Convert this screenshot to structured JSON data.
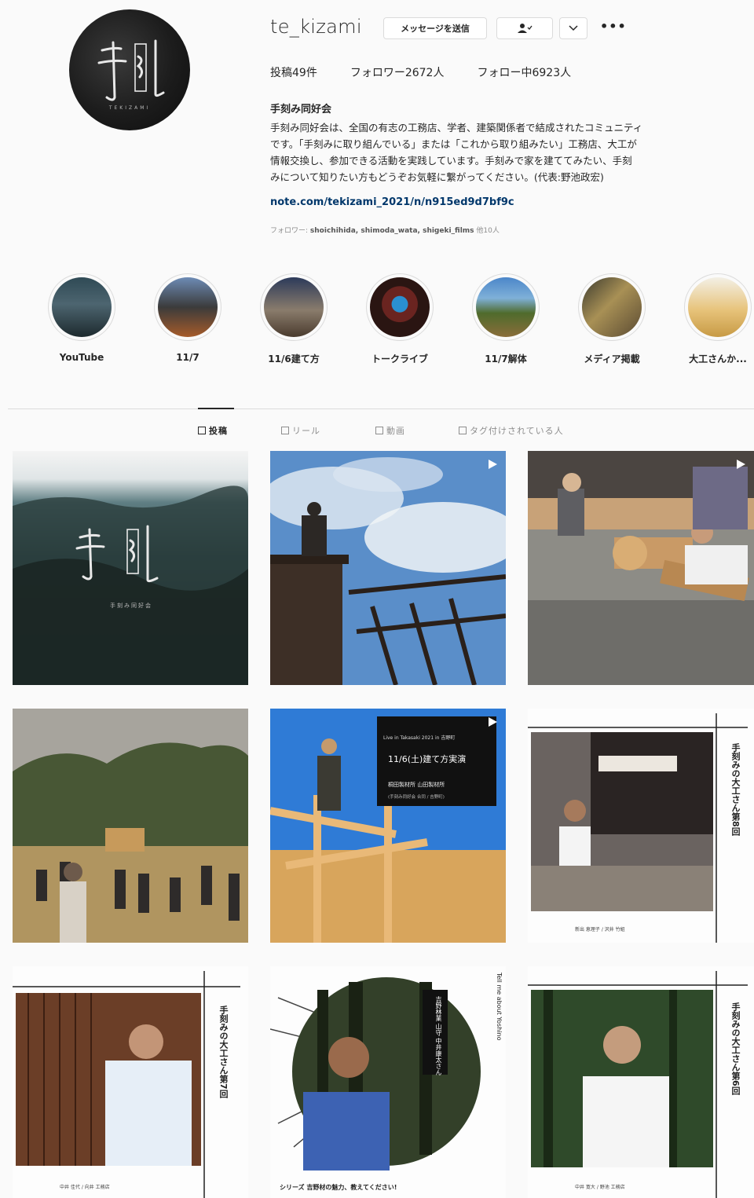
{
  "profile": {
    "username": "te_kizami",
    "avatar_text": "手刻",
    "avatar_sub": "TEKIZAMI",
    "message_button": "メッセージを送信",
    "follow_icon": "person-check-icon",
    "dropdown_icon": "chevron-down-icon",
    "more_icon": "•••",
    "stats": {
      "posts": "投稿49件",
      "followers": "フォロワー2672人",
      "following": "フォロー中6923人"
    },
    "bio_name": "手刻み同好会",
    "bio_text": "手刻み同好会は、全国の有志の工務店、学者、建築関係者で結成されたコミュニティ\nです。「手刻みに取り組んでいる」または「これから取り組みたい」工務店、大工が\n情報交換し、参加できる活動を実践しています。手刻みで家を建ててみたい、手刻\nみについて知りたい方もどうぞお気軽に繋がってください。(代表:野池政宏)",
    "bio_link": "note.com/tekizami_2021/n/n915ed9d7bf9c",
    "followed_by_prefix": "フォロワー:",
    "followed_by_names": "shoichihida, shimoda_wata, shigeki_films",
    "followed_by_suffix": "他10人"
  },
  "highlights": [
    {
      "label": "YouTube"
    },
    {
      "label": "11/7"
    },
    {
      "label": "11/6建て方"
    },
    {
      "label": "トークライブ"
    },
    {
      "label": "11/7解体"
    },
    {
      "label": "メディア掲載"
    },
    {
      "label": "大工さんか..."
    }
  ],
  "tabs": [
    {
      "label": "投稿",
      "icon": "grid-icon",
      "active": true
    },
    {
      "label": "リール",
      "icon": "reels-icon",
      "active": false
    },
    {
      "label": "動画",
      "icon": "video-icon",
      "active": false
    },
    {
      "label": "タグ付けされている人",
      "icon": "tag-icon",
      "active": false
    }
  ],
  "posts": {
    "p1_logo": "手刻",
    "p1_sub": "手刻み同好会",
    "p5_small": "Live in Takasaki 2021 in 吉野町",
    "p5_title": "11/6(土)建て方実演",
    "p5_line2": "桐田製材所 山田製材所",
    "p5_line3": "(手刻み同好会 合同 / 吉野町)",
    "p6_vertical": "手刻みの大工さん第8回",
    "p6_footer": "新出 恵理子   / 沢井 竹組",
    "p8_vertical": "手刻みの大工さん第7回",
    "p8_footer": "中井 佳代   / 向井 工務店",
    "p9_vertical": "吉野林業 山守 中井康太さん",
    "p9_side": "Tell me about Yoshino",
    "p9_footer": "シリーズ 吉野材の魅力、教えてください!",
    "p10_vertical": "手刻みの大工さん第6回",
    "p10_footer": "中井 寛大   / 野池 工務店"
  },
  "colors": {
    "link": "#00376b",
    "text": "#262626",
    "muted": "#8e8e8e",
    "border": "#dbdbdb"
  }
}
